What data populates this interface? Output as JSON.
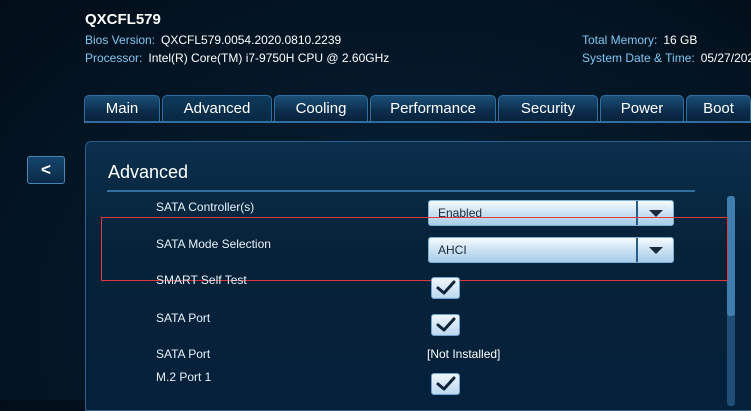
{
  "header": {
    "model": "QXCFL579",
    "bios_version_label": "Bios Version:",
    "bios_version_value": "QXCFL579.0054.2020.0810.2239",
    "processor_label": "Processor:",
    "processor_value": "Intel(R) Core(TM) i7-9750H CPU @ 2.60GHz",
    "total_memory_label": "Total Memory:",
    "total_memory_value": "16 GB",
    "system_date_label": "System Date & Time:",
    "system_date_value": "05/27/202"
  },
  "tabs": [
    "Main",
    "Advanced",
    "Cooling",
    "Performance",
    "Security",
    "Power",
    "Boot"
  ],
  "active_tab": "Advanced",
  "back_label": "<",
  "panel": {
    "title": "Advanced",
    "rows": [
      {
        "label": "SATA Controller(s)",
        "control": "dropdown",
        "value": "Enabled"
      },
      {
        "label": "SATA Mode Selection",
        "control": "dropdown",
        "value": "AHCI"
      },
      {
        "label": "SMART Self Test",
        "control": "checkbox",
        "checked": true
      },
      {
        "label": "SATA Port",
        "control": "checkbox",
        "checked": true
      },
      {
        "label": "SATA Port",
        "control": "text",
        "value": "[Not Installed]"
      },
      {
        "label": "M.2 Port 1",
        "control": "checkbox",
        "checked": true
      }
    ]
  },
  "colors": {
    "accent": "#7fc8f2",
    "highlight": "#e2383e",
    "background": "#041a2c"
  }
}
